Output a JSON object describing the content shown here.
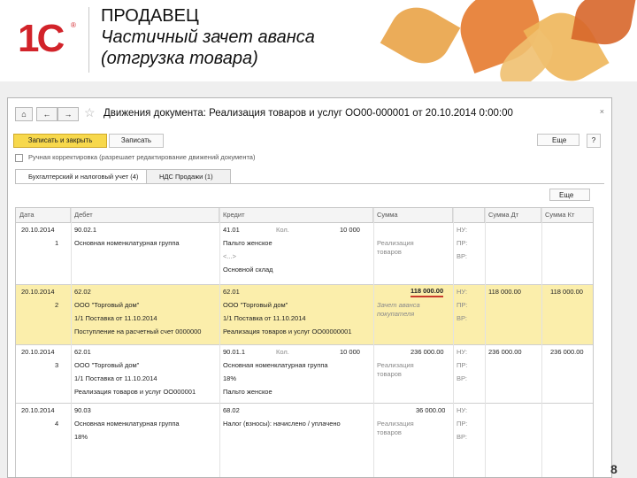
{
  "slide": {
    "logo_text": "1С",
    "title_line1": "ПРОДАВЕЦ",
    "title_line2": "Частичный зачет аванса",
    "title_line3": "(отгрузка товара)",
    "page_number": "8"
  },
  "window": {
    "nav_home": "⌂",
    "nav_back": "←",
    "nav_forward": "→",
    "title": "Движения документа: Реализация товаров и услуг ОО00-000001 от 20.10.2014 0:00:00",
    "close": "×",
    "save_close_label": "Записать и закрыть",
    "post_label": "Записать",
    "more_label": "Еще",
    "help_label": "?",
    "manual_edit_label": "Ручная корректировка (разрешает редактирование движений документа)",
    "tabs": [
      {
        "label": "Бухгалтерский и налоговый учет (4)"
      },
      {
        "label": "НДС Продажи (1)"
      }
    ],
    "table_more_label": "Еще"
  },
  "table": {
    "headers": [
      "Дата",
      "Дебет",
      "Кредит",
      "Сумма",
      "",
      "Сумма Дт",
      "Сумма Кт"
    ],
    "rows": [
      {
        "date": "20.10.2014",
        "num": "1",
        "debit": [
          "90.02.1",
          "Основная номенклатурная группа",
          ""
        ],
        "credit": [
          "41.01",
          "Пальто женское",
          "<...>",
          "Основной склад"
        ],
        "credit_qty_label": "Кол.",
        "credit_qty": "10 000",
        "amount": "",
        "amount_note": [
          "Реализация",
          "товаров"
        ],
        "nu": [
          "НУ:",
          "ПР:",
          "ВР:"
        ],
        "sum_dt": "",
        "sum_kt": ""
      },
      {
        "date": "20.10.2014",
        "num": "2",
        "debit": [
          "62.02",
          "ООО \"Торговый дом\"",
          "1/1 Поставка от 11.10.2014",
          "Поступление на расчетный счет 0000000"
        ],
        "credit": [
          "62.01",
          "ООО \"Торговый дом\"",
          "1/1 Поставка от 11.10.2014",
          "Реализация товаров и услуг ОО00000001"
        ],
        "amount": "118 000.00",
        "amount_note": [
          "Зачет аванса",
          "покупателя"
        ],
        "nu": [
          "НУ:",
          "ПР:",
          "ВР:"
        ],
        "sum_dt": "118 000.00",
        "sum_kt": "118 000.00"
      },
      {
        "date": "20.10.2014",
        "num": "3",
        "debit": [
          "62.01",
          "ООО \"Торговый дом\"",
          "1/1 Поставка от 11.10.2014",
          "Реализация товаров и услуг ОО000001"
        ],
        "credit": [
          "90.01.1",
          "Основная номенклатурная группа",
          "18%",
          "Пальто женское"
        ],
        "credit_qty_label": "Кол.",
        "credit_qty": "10 000",
        "amount": "236 000.00",
        "amount_note": [
          "Реализация",
          "товаров"
        ],
        "nu": [
          "НУ:",
          "ПР:",
          "ВР:"
        ],
        "sum_dt": "236 000.00",
        "sum_kt": "236 000.00"
      },
      {
        "date": "20.10.2014",
        "num": "4",
        "debit": [
          "90.03",
          "Основная номенклатурная группа",
          "18%"
        ],
        "credit": [
          "68.02",
          "Налог (взносы): начислено / уплачено"
        ],
        "amount": "36 000.00",
        "amount_note": [
          "Реализация",
          "товаров"
        ],
        "nu": [
          "НУ:",
          "ПР:",
          "ВР:"
        ],
        "sum_dt": "",
        "sum_kt": ""
      }
    ]
  },
  "colors": {
    "logo_red": "#d2232a",
    "primary_button": "#f7d84c",
    "selected_row": "#fbeeab",
    "amount_underline": "#c93a2c"
  }
}
